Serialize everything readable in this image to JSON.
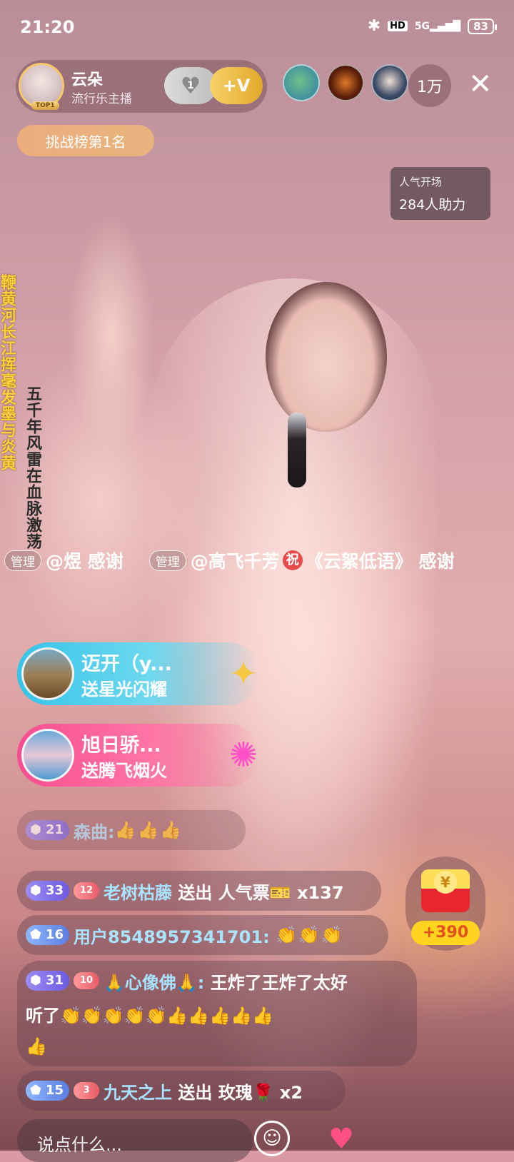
{
  "status": {
    "time": "21:20",
    "hd": "HD",
    "signal": "5G",
    "battery": "83"
  },
  "host": {
    "name": "云朵",
    "subtitle": "流行乐主播",
    "badge": "TOP1",
    "heart_count": "1",
    "v_label": "+V"
  },
  "viewers": {
    "count": "1万"
  },
  "rank_badge": "挑战榜第1名",
  "popularity": {
    "title": "人气开场",
    "value": "284人助力"
  },
  "side_text": {
    "yellow": "鞭黄河长江挥毫发墨与炎黄",
    "dark": "五千年风雷在血脉激荡"
  },
  "ticker": {
    "tag1": "管理",
    "text1": "@煜 感谢",
    "tag2": "管理",
    "text2": "@高飞千芳",
    "zhu": "祝",
    "text3": "《云絮低语》 感谢"
  },
  "gifts": [
    {
      "name": "迈开（y...",
      "action": "送星光闪耀",
      "icon": "wand-icon"
    },
    {
      "name": "旭日骄...",
      "action": "送腾飞烟火",
      "icon": "firework-icon"
    }
  ],
  "chat": [
    {
      "level": "21",
      "user": "森曲:",
      "text": "👍👍👍"
    },
    {
      "level": "33",
      "fan": "12",
      "user": "老树枯藤",
      "text": "送出 人气票🎫 x137"
    },
    {
      "level": "16",
      "user": "用户8548957341701:",
      "text": "👏👏👏"
    },
    {
      "level": "31",
      "fan": "10",
      "user": "🙏心像佛🙏:",
      "text": "王炸了王炸了太好",
      "text2": "听了👏👏👏👏👏👍👍👍👍👍",
      "text3": "👍"
    },
    {
      "level": "15",
      "fan": "3",
      "user": "九天之上",
      "text": "送出 玫瑰🌹 x2"
    }
  ],
  "treasure": {
    "coin": "¥",
    "amount": "+390"
  },
  "input": {
    "placeholder": "说点什么..."
  },
  "icons": {
    "bluetooth": "bluetooth-icon",
    "close": "close-icon",
    "smile": "smile-icon",
    "heart": "heart-icon"
  }
}
